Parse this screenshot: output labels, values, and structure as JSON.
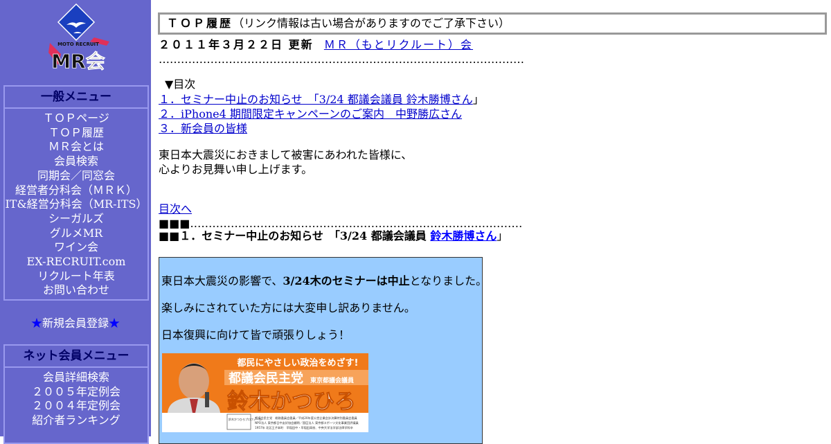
{
  "logo": {
    "alt": "MOTO RECRUIT MR会",
    "brand_small": "MOTO RECRUIT",
    "brand_big": "MR会"
  },
  "sidebar": {
    "general_menu": {
      "title": "一般メニュー",
      "items": [
        "ＴＯＰページ",
        "ＴＯＰ履歴",
        "ＭＲ会とは",
        "会員検索",
        "同期会／同窓会",
        "経営者分科会（ＭＲＫ）",
        "IT&経営分科会（MR-ITS）",
        "シーガルズ",
        "グルメMR",
        "ワイン会",
        "EX-RECRUIT.com",
        "リクルート年表",
        "お問い合わせ"
      ]
    },
    "new_member": {
      "star_left": "★",
      "label": "新規会員登録",
      "star_right": "★"
    },
    "net_menu": {
      "title": "ネット会員メニュー",
      "items": [
        "会員詳細検索",
        "２００５年定例会",
        "２００４年定例会",
        "紹介者ランキング"
      ]
    }
  },
  "main": {
    "title_strong": "ＴＯＰ履歴",
    "title_note": "（リンク情報は古い場合がありますのでご了承下さい）",
    "update_date": "２０１１年３月２２日 更新",
    "update_link": "ＭＲ（もとリクルート）会",
    "dots1": "………………………………………………………………………………………",
    "toc_label": "▼目次",
    "toc": [
      {
        "text": "１．セミナー中止のお知らせ　「3/24 都議会議員 鈴木勝博さん",
        "tail": "」"
      },
      {
        "text": "２．iPhone4 期間限定キャンペーンのご案内　中野勝広さん",
        "tail": ""
      },
      {
        "text": "３．新会員の皆様",
        "tail": ""
      }
    ],
    "condolence_1": "東日本大震災におきまして被害にあわれた皆様に、",
    "condolence_2": "心よりお見舞い申し上げます。",
    "back_to_toc": "目次へ",
    "section_marker": "■■■",
    "dots2": "………………………………………………………………………………",
    "section_title_prefix": "■■１．セミナー中止のお知らせ　「3/24 都議会議員 ",
    "section_title_link": "鈴木勝博さん",
    "section_title_suffix": "」",
    "notice": {
      "line1_a": "東日本大震災の影響で、",
      "line1_b": "3/24木のセミナーは中止",
      "line1_c": "となりました。",
      "line2": "楽しみにされていた方には大変申し訳ありません。",
      "line3": "日本復興に向けて皆で頑張りしょう！"
    },
    "banner": {
      "tagline": "都民にやさしい政治をめざす!",
      "party": "都議会民主党",
      "role": "東京都議会議員",
      "name": "鈴木かつひろ",
      "profile_label": "鈴木かつひろプロフィール",
      "profile_1": "都議会民主党　総務委員会委員／平成20年度公営企業会計決算特別委員会委員",
      "profile_2": "NPO法人 東京都日中友好協会顧問／国臣法人 東京都スポーツ文化事業団評議員",
      "profile_3": "1957年 北区王子本町　早稲田中・早稲田高校、中央大学法学部法律学科卒"
    }
  },
  "colors": {
    "sidebar_bg": "#6666cc",
    "menu_border": "#9999ee",
    "menu_title": "#000066",
    "link": "#0000cc",
    "notice_bg": "#99ccff",
    "banner_orange": "#f07a1a"
  }
}
